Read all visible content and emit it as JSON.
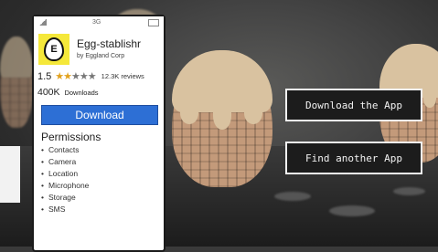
{
  "status_bar": {
    "network": "3G"
  },
  "app": {
    "icon_letter": "E",
    "name": "Egg-stablishr",
    "company": "by Eggland Corp",
    "rating": "1.5",
    "rating_value": 1.5,
    "rating_max": 5,
    "reviews": "12.3K reviews",
    "downloads_count": "400K",
    "downloads_label": "Downloads",
    "download_button": "Download"
  },
  "permissions": {
    "title": "Permissions",
    "items": [
      "Contacts",
      "Camera",
      "Location",
      "Microphone",
      "Storage",
      "SMS"
    ]
  },
  "actions": {
    "download_app": "Download the App",
    "find_another": "Find another App"
  },
  "colors": {
    "download_button": "#2d6fd5",
    "app_icon_bg": "#f5e83a",
    "star": "#e2a21e"
  }
}
